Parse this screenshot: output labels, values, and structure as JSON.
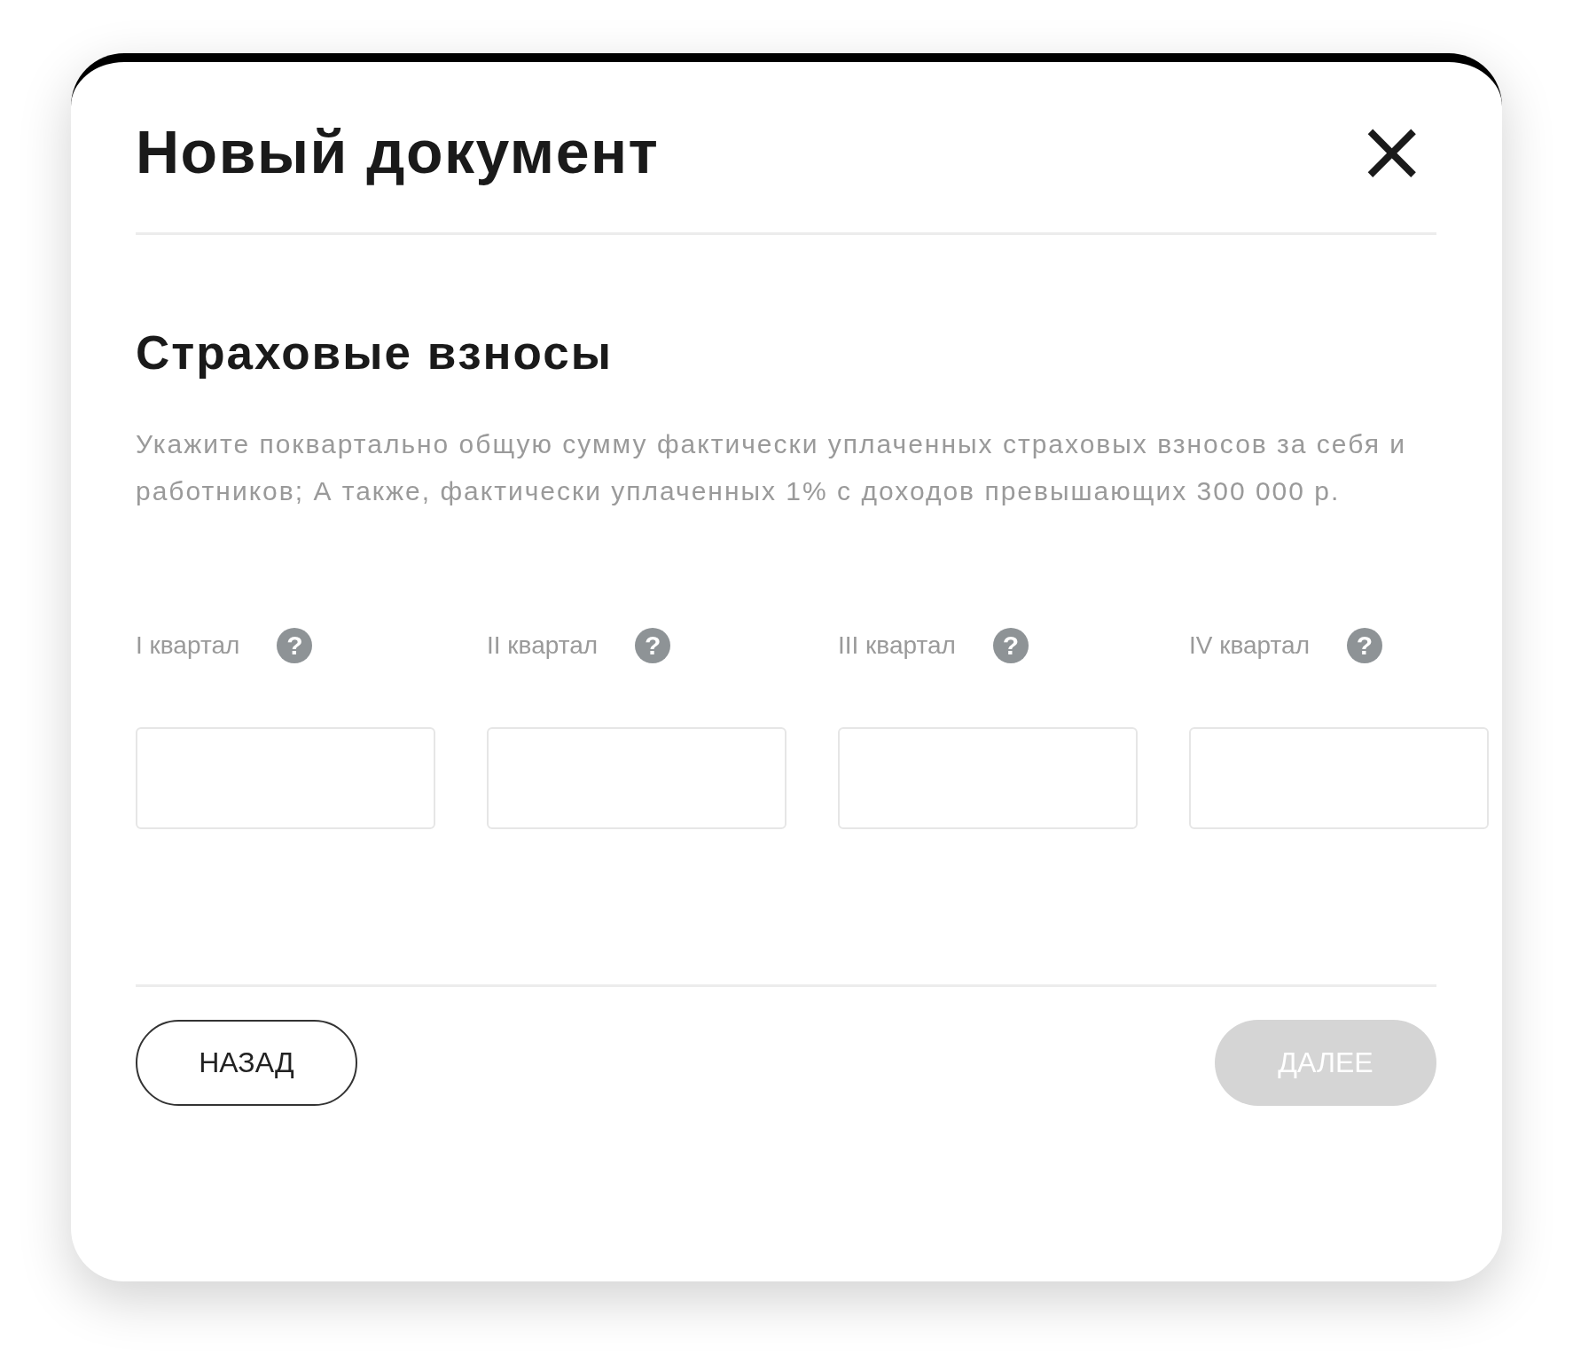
{
  "dialog": {
    "title": "Новый документ",
    "close": "×"
  },
  "section": {
    "title": "Страховые взносы",
    "description": "Укажите поквартально общую сумму фактически уплаченных страховых взносов за себя и работников; А также, фактически уплаченных 1% с доходов превышающих 300 000 р."
  },
  "quarters": [
    {
      "label": "I квартал",
      "help": "?"
    },
    {
      "label": "II квартал",
      "help": "?"
    },
    {
      "label": "III квартал",
      "help": "?"
    },
    {
      "label": "IV квартал",
      "help": "?"
    }
  ],
  "buttons": [
    {
      "kind": "back",
      "label": "НАЗАД",
      "disabled": false
    },
    {
      "kind": "next",
      "label": "ДАЛЕЕ",
      "disabled": true
    }
  ]
}
